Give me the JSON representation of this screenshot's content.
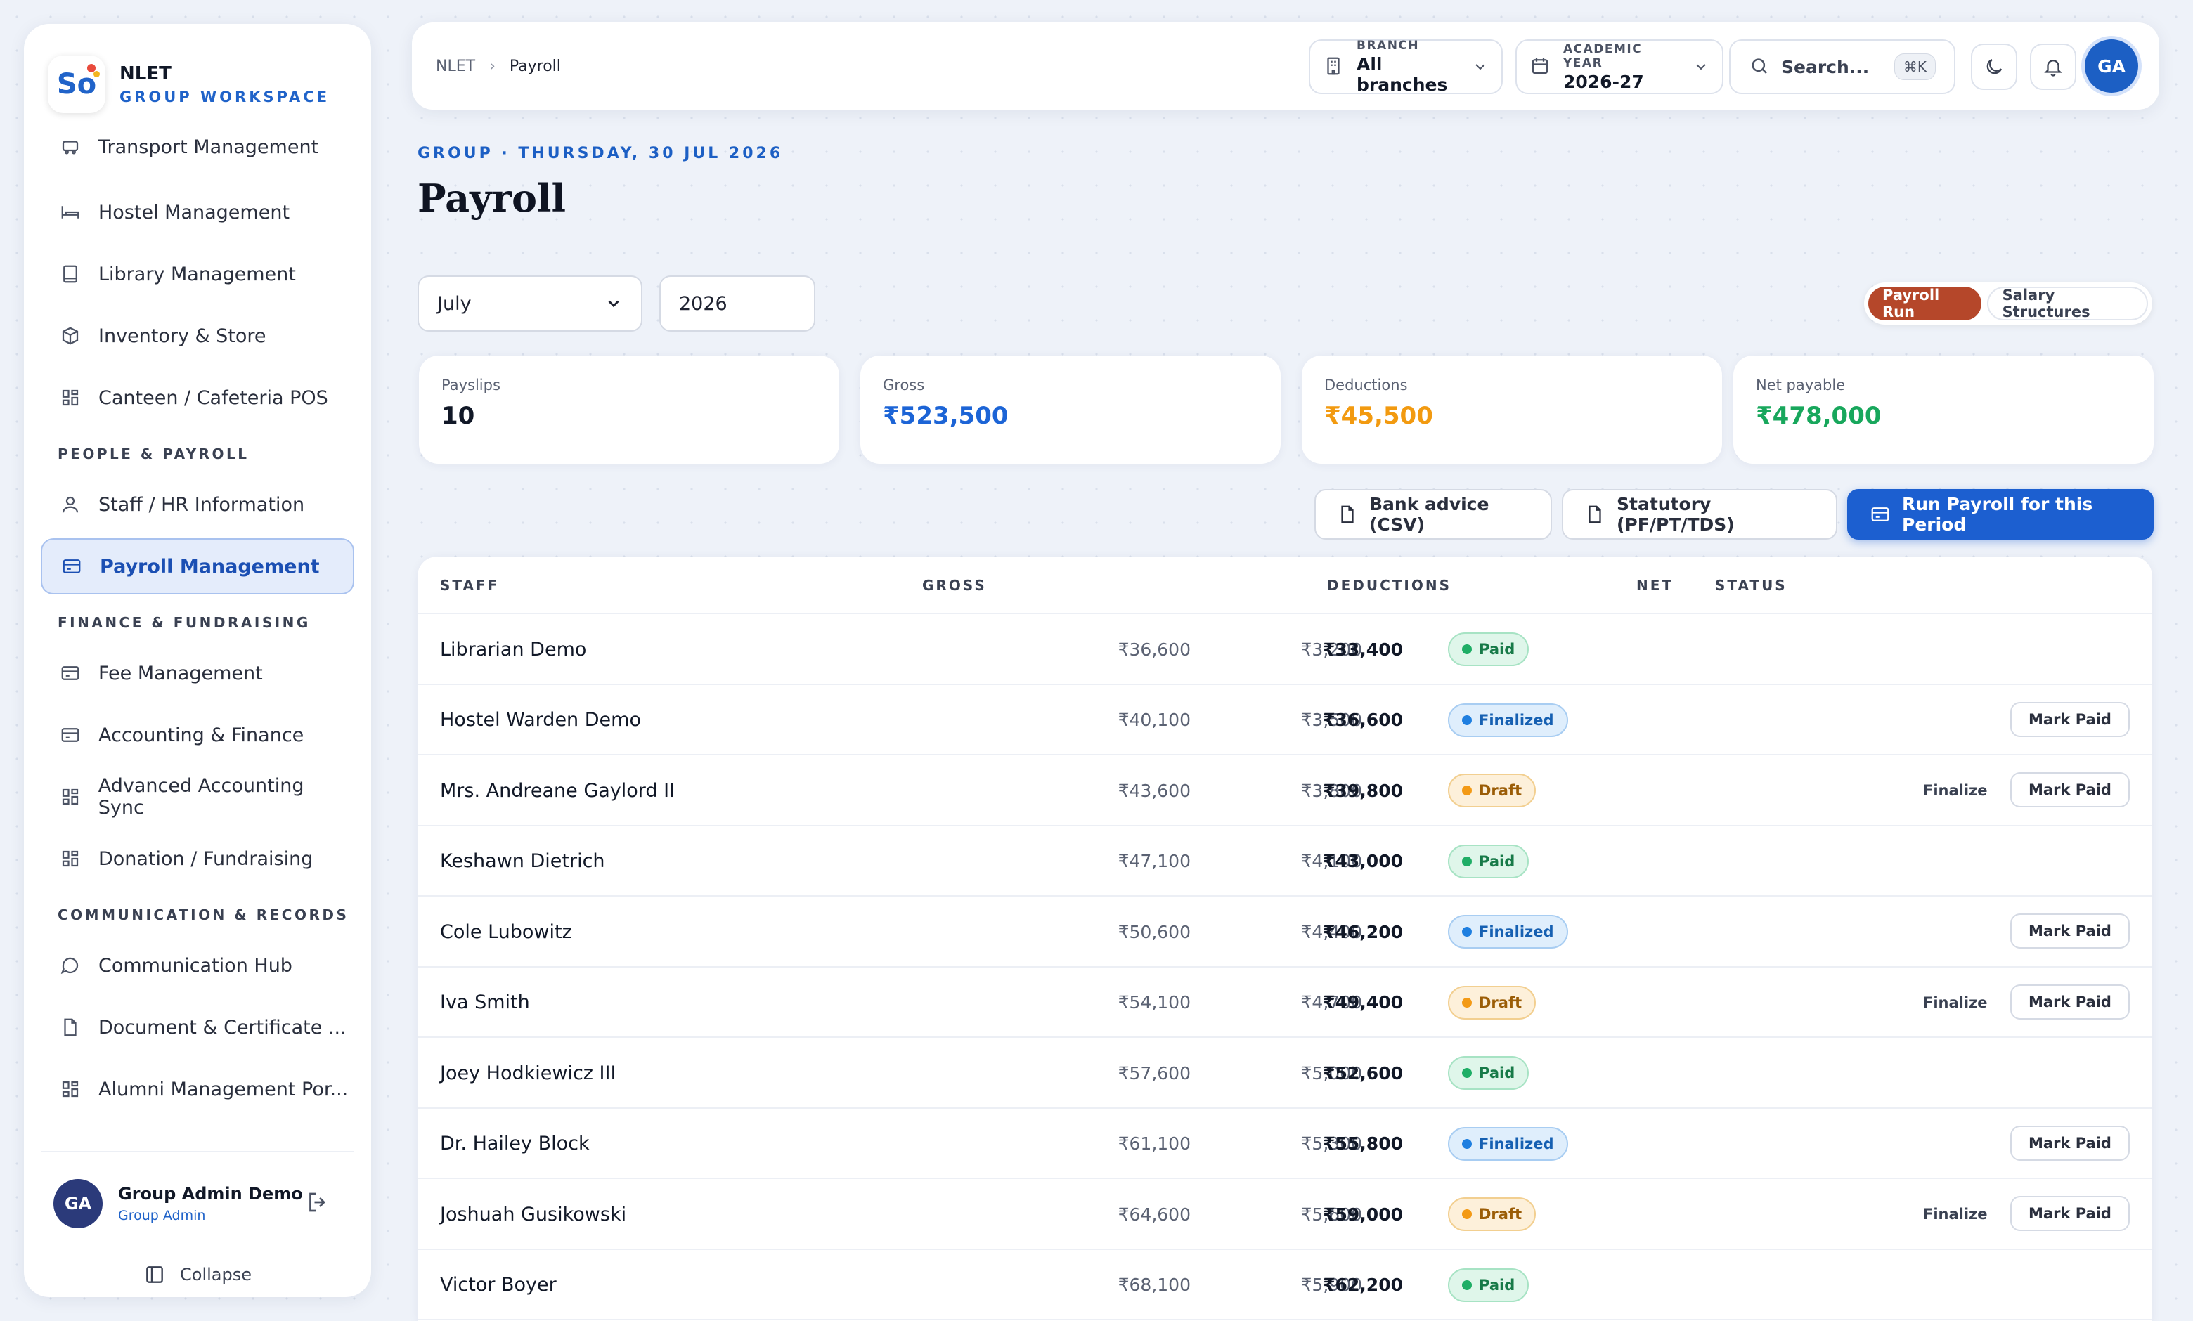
{
  "brand": {
    "name": "NLET",
    "subtitle": "GROUP WORKSPACE",
    "logo_text": "So"
  },
  "sidebar": {
    "partial_item": "Transport Management",
    "items_top": [
      {
        "label": "Hostel Management",
        "icon": "bed-icon"
      },
      {
        "label": "Library Management",
        "icon": "book-icon"
      },
      {
        "label": "Inventory & Store",
        "icon": "box-icon"
      },
      {
        "label": "Canteen / Cafeteria POS",
        "icon": "grid-icon"
      }
    ],
    "section_people": "PEOPLE & PAYROLL",
    "items_people": [
      {
        "label": "Staff / HR Information",
        "icon": "user-icon"
      },
      {
        "label": "Payroll Management",
        "icon": "card-icon",
        "active": true
      }
    ],
    "section_finance": "FINANCE & FUNDRAISING",
    "items_finance": [
      {
        "label": "Fee Management",
        "icon": "card-icon"
      },
      {
        "label": "Accounting & Finance",
        "icon": "card-icon"
      },
      {
        "label": "Advanced Accounting Sync",
        "icon": "grid-icon"
      },
      {
        "label": "Donation / Fundraising",
        "icon": "grid-icon"
      }
    ],
    "section_comm": "COMMUNICATION & RECORDS",
    "items_comm": [
      {
        "label": "Communication Hub",
        "icon": "chat-icon"
      },
      {
        "label": "Document & Certificate ...",
        "icon": "file-icon"
      },
      {
        "label": "Alumni Management Por...",
        "icon": "grid-icon"
      }
    ],
    "user": {
      "initials": "GA",
      "name": "Group Admin Demo",
      "role": "Group Admin"
    },
    "collapse_label": "Collapse"
  },
  "topbar": {
    "breadcrumb": [
      "NLET",
      "Payroll"
    ],
    "branch": {
      "label": "BRANCH",
      "value": "All branches"
    },
    "year": {
      "label": "ACADEMIC YEAR",
      "value": "2026-27"
    },
    "search": {
      "placeholder": "Search...",
      "shortcut": "⌘K"
    },
    "avatar": "GA"
  },
  "page": {
    "eyebrow": "GROUP · THURSDAY, 30 JUL 2026",
    "title": "Payroll",
    "month": "July",
    "year": "2026",
    "tabs": {
      "run": "Payroll Run",
      "structures": "Salary Structures"
    }
  },
  "stats": [
    {
      "label": "Payslips",
      "value": "10",
      "color": "#111827"
    },
    {
      "label": "Gross",
      "value": "₹523,500",
      "color": "#1c64d6"
    },
    {
      "label": "Deductions",
      "value": "₹45,500",
      "color": "#f29a10"
    },
    {
      "label": "Net payable",
      "value": "₹478,000",
      "color": "#18a75c"
    }
  ],
  "actions": {
    "bank": "Bank advice (CSV)",
    "statutory": "Statutory (PF/PT/TDS)",
    "run": "Run Payroll for this Period"
  },
  "table": {
    "headers": {
      "staff": "STAFF",
      "gross": "GROSS",
      "deductions": "DEDUCTIONS",
      "net": "NET",
      "status": "STATUS"
    },
    "finalize_label": "Finalize",
    "mark_paid_label": "Mark Paid",
    "rows": [
      {
        "name": "Librarian Demo",
        "gross": "₹36,600",
        "deductions": "₹3,200",
        "net": "₹33,400",
        "status": "Paid"
      },
      {
        "name": "Hostel Warden Demo",
        "gross": "₹40,100",
        "deductions": "₹3,500",
        "net": "₹36,600",
        "status": "Finalized"
      },
      {
        "name": "Mrs. Andreane Gaylord II",
        "gross": "₹43,600",
        "deductions": "₹3,800",
        "net": "₹39,800",
        "status": "Draft"
      },
      {
        "name": "Keshawn Dietrich",
        "gross": "₹47,100",
        "deductions": "₹4,100",
        "net": "₹43,000",
        "status": "Paid"
      },
      {
        "name": "Cole Lubowitz",
        "gross": "₹50,600",
        "deductions": "₹4,400",
        "net": "₹46,200",
        "status": "Finalized"
      },
      {
        "name": "Iva Smith",
        "gross": "₹54,100",
        "deductions": "₹4,700",
        "net": "₹49,400",
        "status": "Draft"
      },
      {
        "name": "Joey Hodkiewicz III",
        "gross": "₹57,600",
        "deductions": "₹5,000",
        "net": "₹52,600",
        "status": "Paid"
      },
      {
        "name": "Dr. Hailey Block",
        "gross": "₹61,100",
        "deductions": "₹5,300",
        "net": "₹55,800",
        "status": "Finalized"
      },
      {
        "name": "Joshuah Gusikowski",
        "gross": "₹64,600",
        "deductions": "₹5,600",
        "net": "₹59,000",
        "status": "Draft"
      },
      {
        "name": "Victor Boyer",
        "gross": "₹68,100",
        "deductions": "₹5,900",
        "net": "₹62,200",
        "status": "Paid"
      }
    ]
  }
}
